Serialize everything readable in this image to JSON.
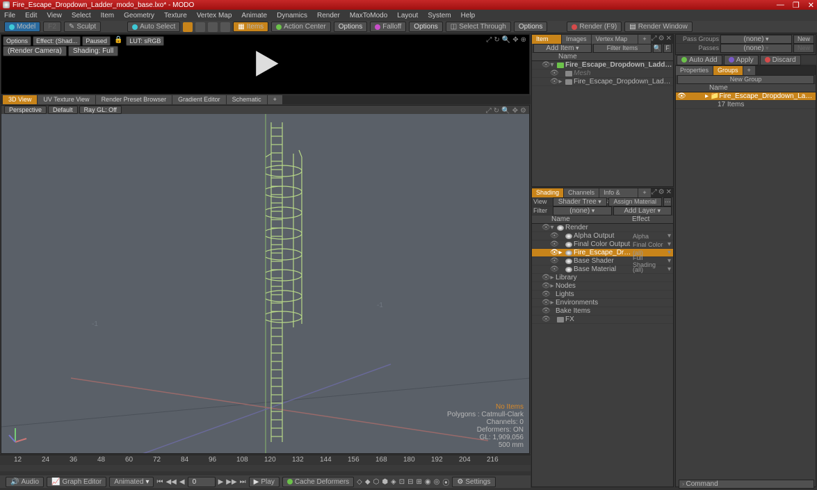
{
  "title": "Fire_Escape_Dropdown_Ladder_modo_base.lxo* - MODO",
  "menu": [
    "File",
    "Edit",
    "View",
    "Select",
    "Item",
    "Geometry",
    "Texture",
    "Vertex Map",
    "Animate",
    "Dynamics",
    "Render",
    "MaxToModo",
    "Layout",
    "System",
    "Help"
  ],
  "toolbar": {
    "model": "Model",
    "sculpt": "Sculpt",
    "autoSelect": "Auto Select",
    "items": "Items",
    "actionCenter": "Action Center",
    "options1": "Options",
    "falloff": "Falloff",
    "options2": "Options",
    "selectThrough": "Select Through",
    "options3": "Options",
    "renderF9": "Render (F9)",
    "renderWindow": "Render Window"
  },
  "preview": {
    "options": "Options",
    "effect": "Effect: (Shad...",
    "paused": "Paused",
    "lut": "LUT: sRGB",
    "renderCam": "(Render Camera)",
    "shading": "Shading: Full"
  },
  "vpTabs": [
    "3D View",
    "UV Texture View",
    "Render Preset Browser",
    "Gradient Editor",
    "Schematic"
  ],
  "vpHeader": {
    "persp": "Perspective",
    "def": "Default",
    "ray": "Ray GL: Off"
  },
  "stats": {
    "noItems": "No Items",
    "poly": "Polygons :  Catmull-Clark",
    "chan": "Channels: 0",
    "def": "Deformers: ON",
    "gl": "GL: 1,909,056",
    "mm": "500 mm"
  },
  "ticks": [
    12,
    24,
    36,
    48,
    60,
    72,
    84,
    96,
    108,
    120,
    132,
    144,
    156,
    168,
    180,
    192,
    204,
    216
  ],
  "tlBtns": {
    "audio": "Audio",
    "graph": "Graph Editor",
    "anim": "Animated",
    "frame": "0",
    "play": "Play",
    "cache": "Cache Deformers",
    "settings": "Settings"
  },
  "itemList": {
    "tabs": [
      "Item List",
      "Images",
      "Vertex Map List"
    ],
    "addItem": "Add Item",
    "filterItems": "Filter Items",
    "nameHdr": "Name",
    "rows": [
      {
        "lbl": "Fire_Escape_Dropdown_Ladder_m...",
        "bold": true,
        "ind": 1,
        "sel": false,
        "exp": "▾",
        "icon": "grp"
      },
      {
        "lbl": "Mesh",
        "ind": 2,
        "icon": "mesh",
        "dim": true
      },
      {
        "lbl": "Fire_Escape_Dropdown_Ladder (2)",
        "ind": 2,
        "exp": "▸",
        "icon": "mesh"
      }
    ]
  },
  "shading": {
    "tabs": [
      "Shading",
      "Channels",
      "Info & Statistics"
    ],
    "view": "View",
    "shaderTree": "Shader Tree",
    "assignMat": "Assign Material",
    "filter": "Filter",
    "none": "(none)",
    "addLayer": "Add Layer",
    "nameHdr": "Name",
    "effectHdr": "Effect",
    "rows": [
      {
        "lbl": "Render",
        "ind": 1,
        "exp": "▾",
        "icon": "mat"
      },
      {
        "lbl": "Alpha Output",
        "ind": 2,
        "eff": "Alpha",
        "icon": "mat"
      },
      {
        "lbl": "Final Color Output",
        "ind": 2,
        "eff": "Final Color",
        "icon": "mat"
      },
      {
        "lbl": "Fire_Escape_Dropdown_L…",
        "ind": 2,
        "exp": "▸",
        "eff": "(all)",
        "sel": true,
        "icon": "mat"
      },
      {
        "lbl": "Base Shader",
        "ind": 2,
        "eff": "Full Shading",
        "icon": "mat"
      },
      {
        "lbl": "Base Material",
        "ind": 2,
        "eff": "(all)",
        "icon": "mat"
      },
      {
        "lbl": "Library",
        "ind": 1,
        "exp": "▸"
      },
      {
        "lbl": "Nodes",
        "ind": 1,
        "exp": "▸"
      },
      {
        "lbl": "Lights",
        "ind": 1
      },
      {
        "lbl": "Environments",
        "ind": 1,
        "exp": "▸"
      },
      {
        "lbl": "Bake Items",
        "ind": 1
      },
      {
        "lbl": "FX",
        "ind": 1,
        "icon": "mesh"
      }
    ]
  },
  "passes": {
    "passGroups": "Pass Groups",
    "none": "(none)",
    "new": "New",
    "passes": "Passes"
  },
  "actions": {
    "autoAdd": "Auto Add",
    "apply": "Apply",
    "discard": "Discard"
  },
  "props": {
    "tabs": [
      "Properties",
      "Groups"
    ],
    "newGroup": "New Group",
    "nameHdr": "Name",
    "item": "Fire_Escape_Dropdown_Ladd...",
    "count": "17 Items"
  },
  "cmd": "Command"
}
